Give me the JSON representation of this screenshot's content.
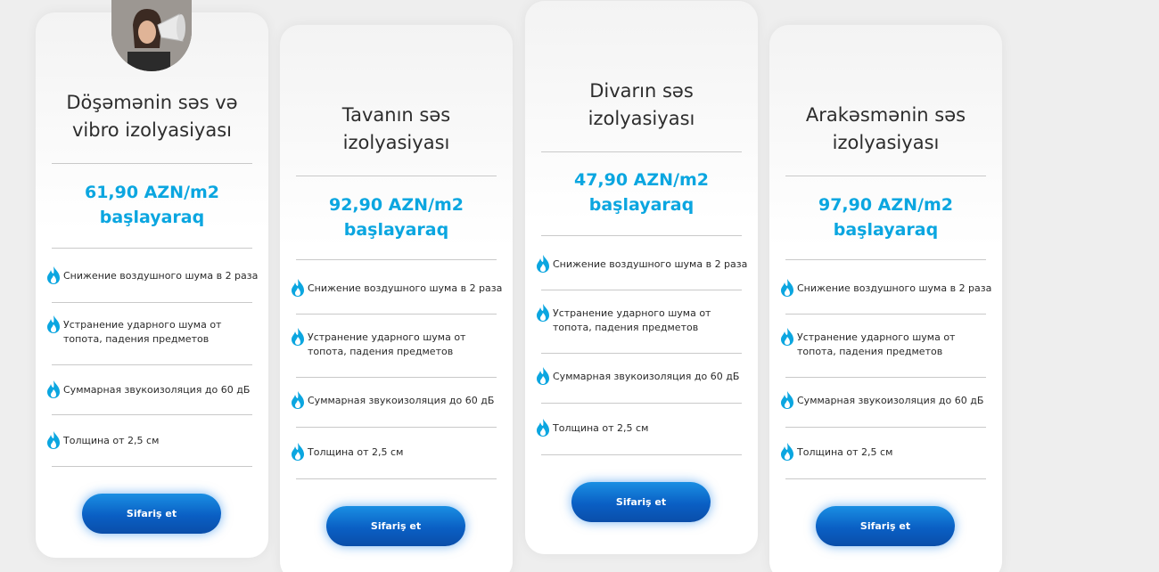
{
  "cards": [
    {
      "title_line1": "Döşəmənin səs və",
      "title_line2": "vibro izolyasiyası",
      "price_line1": "61,90 AZN/m2",
      "price_line2": "başlayaraq",
      "features": [
        "Снижение воздушного шума в 2 раза",
        "Устранение ударного шума от топота, падения предметов",
        "Суммарная звукоизоляция до 60 дБ",
        "Толщина от 2,5 см"
      ],
      "button": "Sifariş et"
    },
    {
      "title_line1": "Tavanın səs",
      "title_line2": "izolyasiyası",
      "price_line1": "92,90 AZN/m2",
      "price_line2": "başlayaraq",
      "features": [
        "Снижение воздушного шума в 2 раза",
        "Устранение ударного шума от топота, падения предметов",
        "Суммарная звукоизоляция до 60 дБ",
        "Толщина от 2,5 см"
      ],
      "button": "Sifariş et"
    },
    {
      "title_line1": "Divarın səs",
      "title_line2": "izolyasiyası",
      "price_line1": "47,90 AZN/m2",
      "price_line2": "başlayaraq",
      "features": [
        "Снижение воздушного шума в 2 раза",
        "Устранение ударного шума от топота, падения предметов",
        "Суммарная звукоизоляция до 60 дБ",
        "Толщина от 2,5 см"
      ],
      "button": "Sifariş et"
    },
    {
      "title_line1": "Arakəsmənin səs",
      "title_line2": "izolyasiyası",
      "price_line1": "97,90 AZN/m2",
      "price_line2": "başlayaraq",
      "features": [
        "Снижение воздушного шума в 2 раза",
        "Устранение ударного шума от топота, падения предметов",
        "Суммарная звукоизоляция до 60 дБ",
        "Толщина от 2,5 см"
      ],
      "button": "Sifariş et"
    }
  ],
  "icons": {
    "feature": "flame-icon",
    "avatar": "person-with-megaphone-photo"
  },
  "colors": {
    "price": "#0ba6e0",
    "button": "#0a5fc4",
    "flame": "#0ba6e0"
  }
}
